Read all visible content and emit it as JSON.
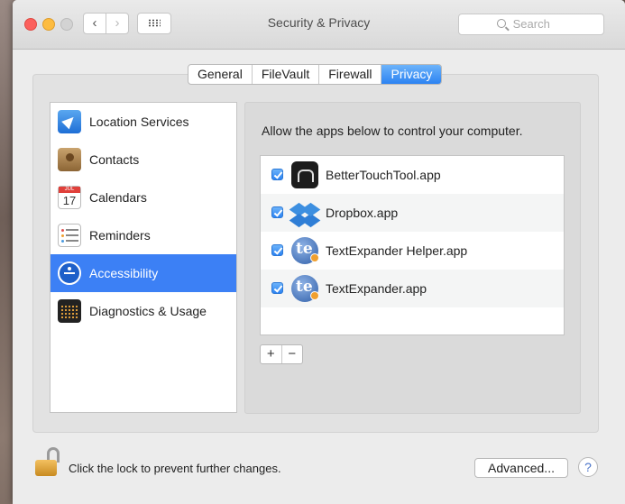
{
  "window": {
    "title": "Security & Privacy",
    "search_placeholder": "Search"
  },
  "tabs": [
    {
      "label": "General",
      "active": false
    },
    {
      "label": "FileVault",
      "active": false
    },
    {
      "label": "Firewall",
      "active": false
    },
    {
      "label": "Privacy",
      "active": true
    }
  ],
  "sidebar": {
    "items": [
      {
        "label": "Location Services",
        "icon": "location-arrow-icon"
      },
      {
        "label": "Contacts",
        "icon": "contacts-book-icon"
      },
      {
        "label": "Calendars",
        "icon": "calendar-icon",
        "calendar_month": "JUL",
        "calendar_day": "17"
      },
      {
        "label": "Reminders",
        "icon": "reminders-list-icon"
      },
      {
        "label": "Accessibility",
        "icon": "accessibility-icon",
        "selected": true
      },
      {
        "label": "Diagnostics & Usage",
        "icon": "diagnostics-icon"
      }
    ]
  },
  "content": {
    "heading": "Allow the apps below to control your computer.",
    "apps": [
      {
        "name": "BetterTouchTool.app",
        "checked": true
      },
      {
        "name": "Dropbox.app",
        "checked": true
      },
      {
        "name": "TextExpander Helper.app",
        "checked": true
      },
      {
        "name": "TextExpander.app",
        "checked": true
      }
    ],
    "add_label": "+",
    "remove_label": "−"
  },
  "footer": {
    "lock_text": "Click the lock to prevent further changes.",
    "advanced_label": "Advanced...",
    "help_label": "?"
  },
  "colors": {
    "accent": "#3c80f5"
  }
}
